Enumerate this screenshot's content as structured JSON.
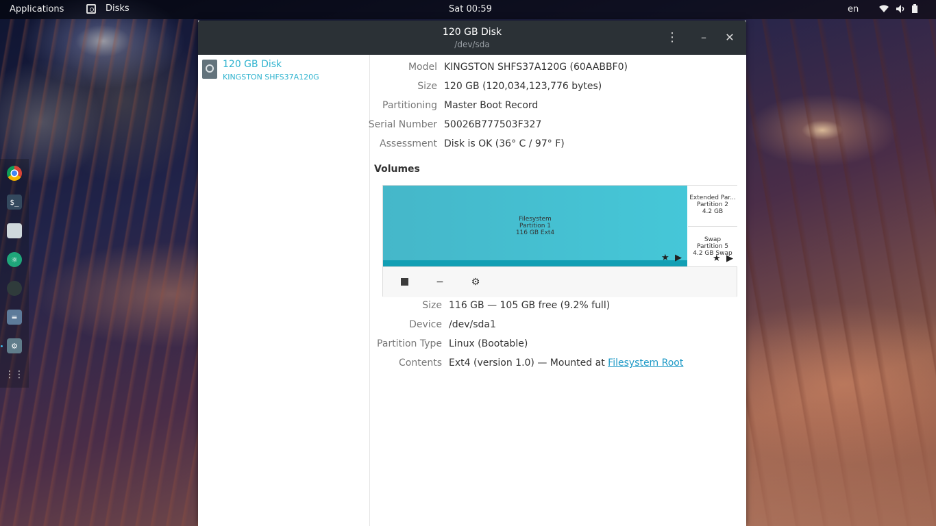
{
  "topbar": {
    "applications": "Applications",
    "active_app": "Disks",
    "clock": "Sat 00:59",
    "lang": "en",
    "icons": [
      "wifi-icon",
      "volume-icon",
      "battery-icon"
    ]
  },
  "dock": {
    "items": [
      "chrome-icon",
      "terminal-icon",
      "files-icon",
      "atom-icon",
      "gitkraken-icon",
      "server-icon",
      "disks-icon",
      "app-grid-icon"
    ]
  },
  "window": {
    "title": "120 GB Disk",
    "subtitle": "/dev/sda"
  },
  "sidebar": {
    "drives": [
      {
        "title": "120 GB Disk",
        "model": "KINGSTON SHFS37A120G"
      }
    ]
  },
  "disk_info": {
    "rows": [
      {
        "key": "Model",
        "value": "KINGSTON SHFS37A120G (60AABBF0)"
      },
      {
        "key": "Size",
        "value": "120 GB (120,034,123,776 bytes)"
      },
      {
        "key": "Partitioning",
        "value": "Master Boot Record"
      },
      {
        "key": "Serial Number",
        "value": "50026B777503F327"
      },
      {
        "key": "Assessment",
        "value": "Disk is OK (36° C / 97° F)"
      }
    ]
  },
  "volumes": {
    "title": "Volumes",
    "main": {
      "line1": "Filesystem",
      "line2": "Partition 1",
      "line3": "116 GB Ext4"
    },
    "extended": {
      "line1": "Extended Par...",
      "line2": "Partition 2",
      "line3": "4.2 GB"
    },
    "swap": {
      "line1": "Swap",
      "line2": "Partition 5",
      "line3": "4.2 GB Swap"
    }
  },
  "partition_info": {
    "rows": [
      {
        "key": "Size",
        "value": "116 GB — 105 GB free (9.2% full)"
      },
      {
        "key": "Device",
        "value": "/dev/sda1"
      },
      {
        "key": "Partition Type",
        "value": "Linux (Bootable)"
      },
      {
        "key": "Contents",
        "value": "Ext4 (version 1.0) — Mounted at "
      }
    ],
    "mount_link": "Filesystem Root"
  }
}
